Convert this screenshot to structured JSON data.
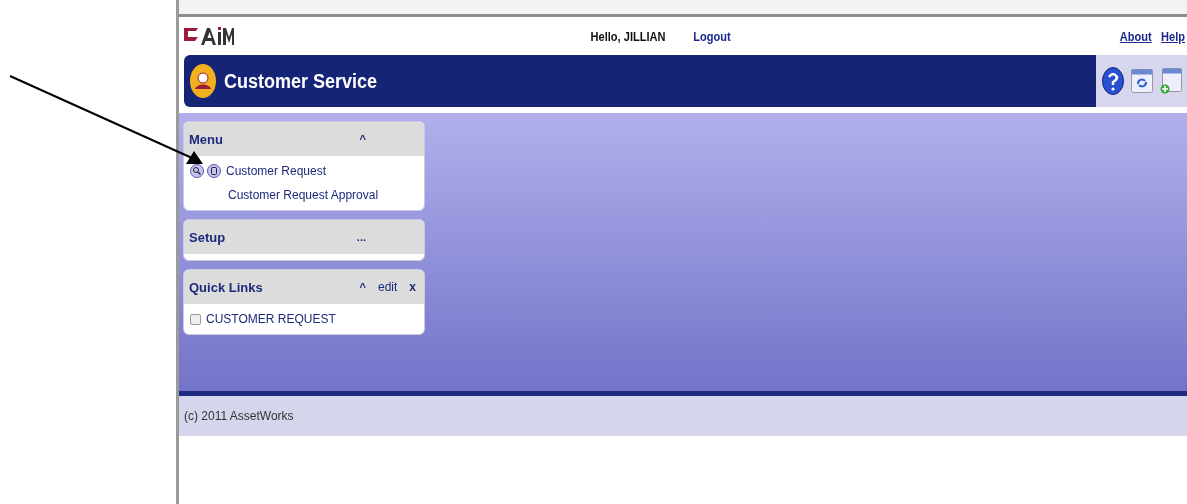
{
  "header": {
    "greeting": "Hello, JILLIAN",
    "logout": "Logout",
    "links": [
      "About",
      "Help"
    ]
  },
  "title_bar": {
    "title": "Customer Service"
  },
  "panels": [
    {
      "title": "Menu",
      "toggle": "^",
      "items": [
        {
          "label": "Customer Request",
          "kind": "icons"
        },
        {
          "label": "Customer Request Approval",
          "kind": "plain"
        }
      ]
    },
    {
      "title": "Setup",
      "toggle": "..."
    },
    {
      "title": "Quick Links",
      "toggle": "^",
      "edit": "edit",
      "close": "x",
      "items": [
        {
          "label": "CUSTOMER REQUEST",
          "kind": "checkbox",
          "checked": false
        }
      ]
    }
  ],
  "footer": {
    "copyright": "(c) 2011 AssetWorks"
  }
}
